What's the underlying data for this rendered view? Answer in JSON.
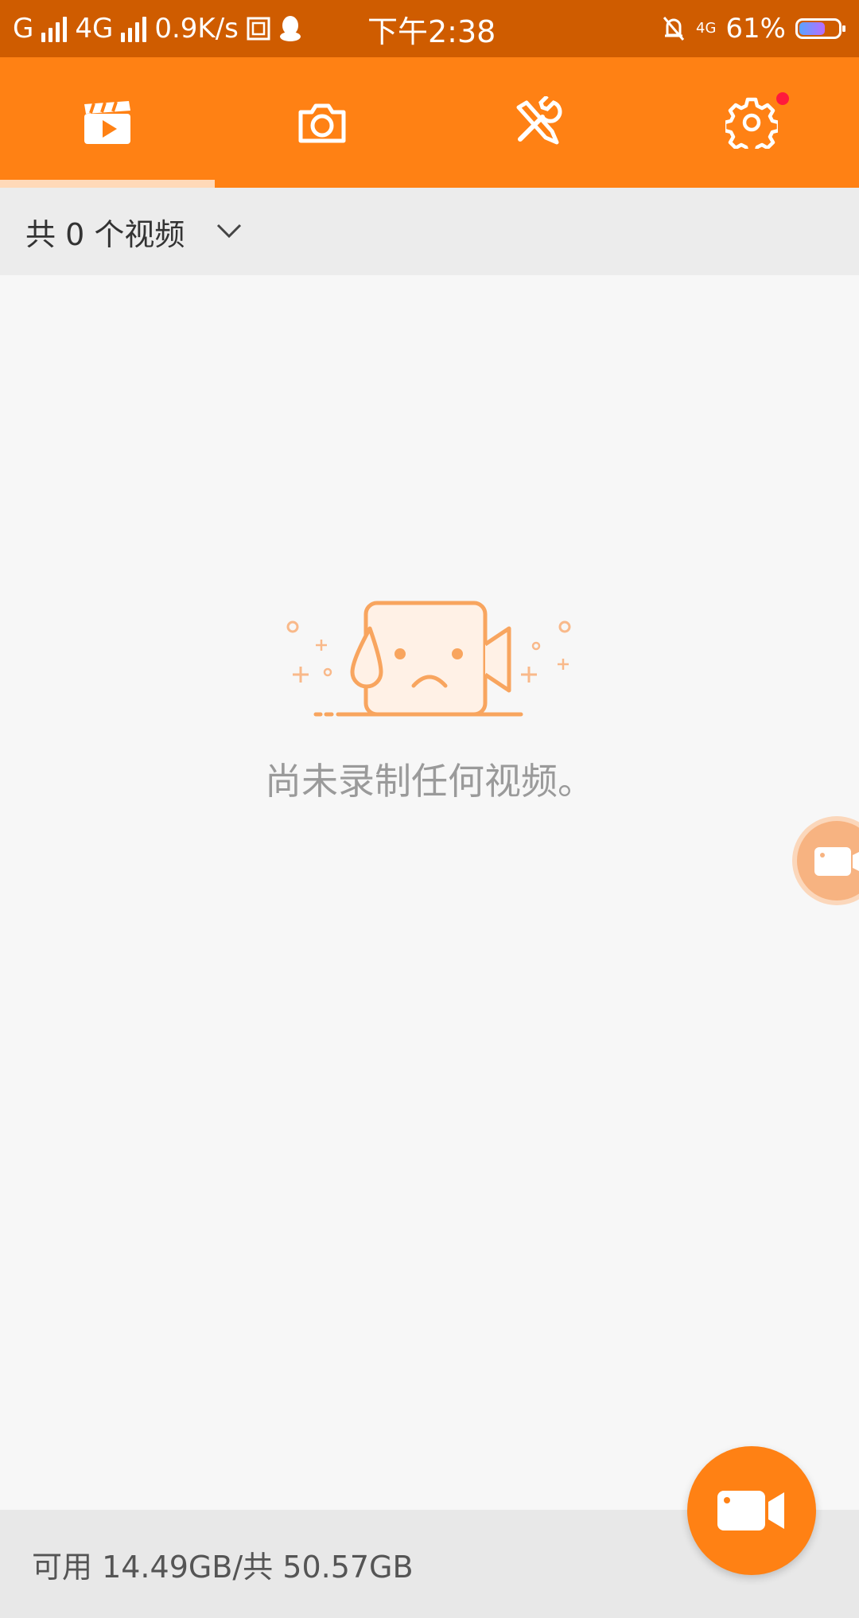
{
  "status_bar": {
    "left_text": "G",
    "network_type": "4G",
    "speed": "0.9K/s",
    "time": "下午2:38",
    "right_network": "4G",
    "battery_percent": "61%",
    "battery_level": 0.61
  },
  "tabs": [
    {
      "name": "videos",
      "icon": "video-clapperboard-icon",
      "selected": true
    },
    {
      "name": "screenshots",
      "icon": "camera-icon",
      "selected": false
    },
    {
      "name": "tools",
      "icon": "tools-icon",
      "selected": false
    },
    {
      "name": "settings",
      "icon": "gear-icon",
      "selected": false,
      "badge": true
    }
  ],
  "filter": {
    "label": "共 0 个视频"
  },
  "empty_state": {
    "message": "尚未录制任何视频。"
  },
  "storage": {
    "text": "可用 14.49GB/共 50.57GB"
  },
  "colors": {
    "accent": "#ff8114",
    "status_bar": "#cf5c00",
    "badge": "#ff1a3c"
  }
}
